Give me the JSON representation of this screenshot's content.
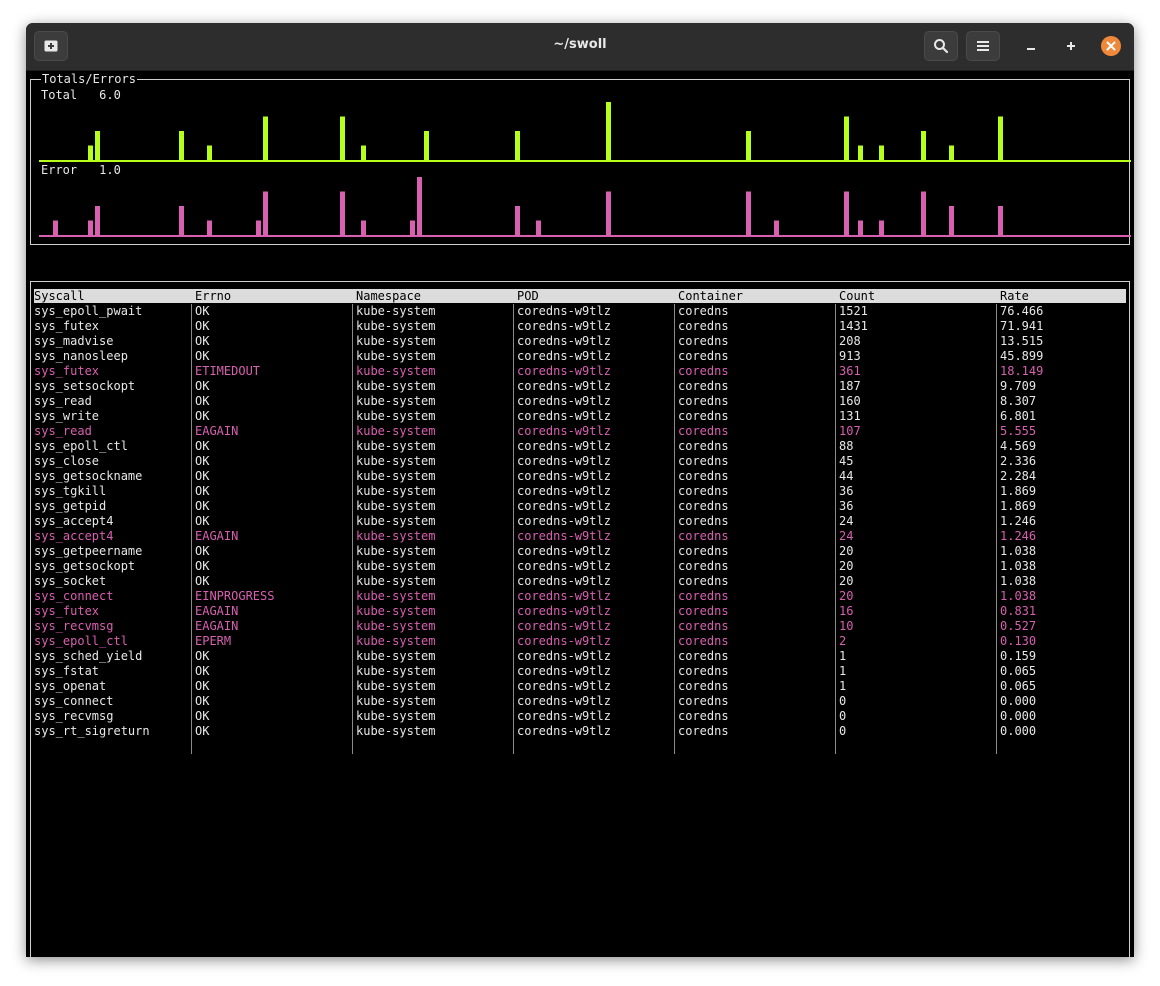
{
  "window": {
    "title": "~/swoll"
  },
  "toolbar": {
    "new_tab_icon": "new-tab-icon",
    "search_icon": "search-icon",
    "menu_icon": "hamburger-menu-icon",
    "minimize_icon": "minimize-icon",
    "maximize_icon": "maximize-icon",
    "close_icon": "close-icon"
  },
  "colors": {
    "total_bars": "#b6ff1a",
    "error_bars": "#d860b0",
    "error_row_text": "#d860b0",
    "close_button": "#f0883a"
  },
  "totals_panel": {
    "title": "Totals/Errors",
    "total_label": "Total",
    "total_value": "6.0",
    "error_label": "Error",
    "error_value": "1.0"
  },
  "chart_data": [
    {
      "type": "bar",
      "series": [
        {
          "name": "Total",
          "values": [
            0,
            0,
            0,
            0,
            0,
            0,
            0,
            1,
            2,
            0,
            0,
            0,
            0,
            0,
            0,
            0,
            0,
            0,
            0,
            0,
            2,
            0,
            0,
            0,
            1,
            0,
            0,
            0,
            0,
            0,
            0,
            0,
            3,
            0,
            0,
            0,
            0,
            0,
            0,
            0,
            0,
            0,
            0,
            3,
            0,
            0,
            1,
            0,
            0,
            0,
            0,
            0,
            0,
            0,
            0,
            2,
            0,
            0,
            0,
            0,
            0,
            0,
            0,
            0,
            0,
            0,
            0,
            0,
            2,
            0,
            0,
            0,
            0,
            0,
            0,
            0,
            0,
            0,
            0,
            0,
            0,
            4,
            0,
            0,
            0,
            0,
            0,
            0,
            0,
            0,
            0,
            0,
            0,
            0,
            0,
            0,
            0,
            0,
            0,
            0,
            0,
            2,
            0,
            0,
            0,
            0,
            0,
            0,
            0,
            0,
            0,
            0,
            0,
            0,
            0,
            3,
            0,
            1,
            0,
            0,
            1,
            0,
            0,
            0,
            0,
            0,
            2,
            0,
            0,
            0,
            1,
            0,
            0,
            0,
            0,
            0,
            0,
            3,
            0,
            0,
            0,
            0,
            0,
            0,
            0,
            0,
            0,
            0,
            0,
            0,
            0,
            0,
            0,
            0,
            0,
            0,
            0,
            0,
            2,
            0,
            0,
            0,
            0,
            0,
            0,
            0,
            0,
            0,
            2,
            1,
            0,
            0,
            0,
            0,
            0,
            0,
            0,
            0,
            0,
            0,
            2
          ]
        }
      ],
      "ylim": [
        0,
        4
      ]
    },
    {
      "type": "bar",
      "series": [
        {
          "name": "Error",
          "values": [
            0,
            0,
            1,
            0,
            0,
            0,
            0,
            1,
            2,
            0,
            0,
            0,
            0,
            0,
            0,
            0,
            0,
            0,
            0,
            0,
            2,
            0,
            0,
            0,
            1,
            0,
            0,
            0,
            0,
            0,
            0,
            1,
            3,
            0,
            0,
            0,
            0,
            0,
            0,
            0,
            0,
            0,
            0,
            3,
            0,
            0,
            1,
            0,
            0,
            0,
            0,
            0,
            0,
            1,
            4,
            0,
            0,
            0,
            0,
            0,
            0,
            0,
            0,
            0,
            0,
            0,
            0,
            0,
            2,
            0,
            0,
            1,
            0,
            0,
            0,
            0,
            0,
            0,
            0,
            0,
            0,
            3,
            0,
            0,
            0,
            0,
            0,
            0,
            0,
            0,
            0,
            0,
            0,
            0,
            0,
            0,
            0,
            0,
            0,
            0,
            0,
            3,
            0,
            0,
            0,
            1,
            0,
            0,
            0,
            0,
            0,
            0,
            0,
            0,
            0,
            3,
            0,
            1,
            0,
            0,
            1,
            0,
            0,
            0,
            0,
            0,
            3,
            0,
            0,
            0,
            2,
            0,
            0,
            0,
            0,
            0,
            0,
            2,
            0,
            0,
            0,
            0,
            0,
            0,
            0,
            0,
            0,
            0,
            0,
            0,
            0,
            0,
            0,
            0,
            0,
            0,
            0,
            0,
            2,
            0,
            0,
            1,
            0,
            0,
            0,
            0,
            0,
            0,
            3,
            1,
            0,
            0,
            0,
            0,
            0,
            0,
            0,
            0,
            0,
            0,
            3
          ]
        }
      ],
      "ylim": [
        0,
        4
      ]
    }
  ],
  "table": {
    "columns": [
      "Syscall",
      "Errno",
      "Namespace",
      "POD",
      "Container",
      "Count",
      "Rate"
    ],
    "rows": [
      {
        "cells": [
          "sys_epoll_pwait",
          "OK",
          "kube-system",
          "coredns-w9tlz",
          "coredns",
          "1521",
          "76.466"
        ],
        "error": false
      },
      {
        "cells": [
          "sys_futex",
          "OK",
          "kube-system",
          "coredns-w9tlz",
          "coredns",
          "1431",
          "71.941"
        ],
        "error": false
      },
      {
        "cells": [
          "sys_madvise",
          "OK",
          "kube-system",
          "coredns-w9tlz",
          "coredns",
          "208",
          "13.515"
        ],
        "error": false
      },
      {
        "cells": [
          "sys_nanosleep",
          "OK",
          "kube-system",
          "coredns-w9tlz",
          "coredns",
          "913",
          "45.899"
        ],
        "error": false
      },
      {
        "cells": [
          "sys_futex",
          "ETIMEDOUT",
          "kube-system",
          "coredns-w9tlz",
          "coredns",
          "361",
          "18.149"
        ],
        "error": true
      },
      {
        "cells": [
          "sys_setsockopt",
          "OK",
          "kube-system",
          "coredns-w9tlz",
          "coredns",
          "187",
          "9.709"
        ],
        "error": false
      },
      {
        "cells": [
          "sys_read",
          "OK",
          "kube-system",
          "coredns-w9tlz",
          "coredns",
          "160",
          "8.307"
        ],
        "error": false
      },
      {
        "cells": [
          "sys_write",
          "OK",
          "kube-system",
          "coredns-w9tlz",
          "coredns",
          "131",
          "6.801"
        ],
        "error": false
      },
      {
        "cells": [
          "sys_read",
          "EAGAIN",
          "kube-system",
          "coredns-w9tlz",
          "coredns",
          "107",
          "5.555"
        ],
        "error": true
      },
      {
        "cells": [
          "sys_epoll_ctl",
          "OK",
          "kube-system",
          "coredns-w9tlz",
          "coredns",
          "88",
          "4.569"
        ],
        "error": false
      },
      {
        "cells": [
          "sys_close",
          "OK",
          "kube-system",
          "coredns-w9tlz",
          "coredns",
          "45",
          "2.336"
        ],
        "error": false
      },
      {
        "cells": [
          "sys_getsockname",
          "OK",
          "kube-system",
          "coredns-w9tlz",
          "coredns",
          "44",
          "2.284"
        ],
        "error": false
      },
      {
        "cells": [
          "sys_tgkill",
          "OK",
          "kube-system",
          "coredns-w9tlz",
          "coredns",
          "36",
          "1.869"
        ],
        "error": false
      },
      {
        "cells": [
          "sys_getpid",
          "OK",
          "kube-system",
          "coredns-w9tlz",
          "coredns",
          "36",
          "1.869"
        ],
        "error": false
      },
      {
        "cells": [
          "sys_accept4",
          "OK",
          "kube-system",
          "coredns-w9tlz",
          "coredns",
          "24",
          "1.246"
        ],
        "error": false
      },
      {
        "cells": [
          "sys_accept4",
          "EAGAIN",
          "kube-system",
          "coredns-w9tlz",
          "coredns",
          "24",
          "1.246"
        ],
        "error": true
      },
      {
        "cells": [
          "sys_getpeername",
          "OK",
          "kube-system",
          "coredns-w9tlz",
          "coredns",
          "20",
          "1.038"
        ],
        "error": false
      },
      {
        "cells": [
          "sys_getsockopt",
          "OK",
          "kube-system",
          "coredns-w9tlz",
          "coredns",
          "20",
          "1.038"
        ],
        "error": false
      },
      {
        "cells": [
          "sys_socket",
          "OK",
          "kube-system",
          "coredns-w9tlz",
          "coredns",
          "20",
          "1.038"
        ],
        "error": false
      },
      {
        "cells": [
          "sys_connect",
          "EINPROGRESS",
          "kube-system",
          "coredns-w9tlz",
          "coredns",
          "20",
          "1.038"
        ],
        "error": true
      },
      {
        "cells": [
          "sys_futex",
          "EAGAIN",
          "kube-system",
          "coredns-w9tlz",
          "coredns",
          "16",
          "0.831"
        ],
        "error": true
      },
      {
        "cells": [
          "sys_recvmsg",
          "EAGAIN",
          "kube-system",
          "coredns-w9tlz",
          "coredns",
          "10",
          "0.527"
        ],
        "error": true
      },
      {
        "cells": [
          "sys_epoll_ctl",
          "EPERM",
          "kube-system",
          "coredns-w9tlz",
          "coredns",
          "2",
          "0.130"
        ],
        "error": true
      },
      {
        "cells": [
          "sys_sched_yield",
          "OK",
          "kube-system",
          "coredns-w9tlz",
          "coredns",
          "1",
          "0.159"
        ],
        "error": false
      },
      {
        "cells": [
          "sys_fstat",
          "OK",
          "kube-system",
          "coredns-w9tlz",
          "coredns",
          "1",
          "0.065"
        ],
        "error": false
      },
      {
        "cells": [
          "sys_openat",
          "OK",
          "kube-system",
          "coredns-w9tlz",
          "coredns",
          "1",
          "0.065"
        ],
        "error": false
      },
      {
        "cells": [
          "sys_connect",
          "OK",
          "kube-system",
          "coredns-w9tlz",
          "coredns",
          "0",
          "0.000"
        ],
        "error": false
      },
      {
        "cells": [
          "sys_recvmsg",
          "OK",
          "kube-system",
          "coredns-w9tlz",
          "coredns",
          "0",
          "0.000"
        ],
        "error": false
      },
      {
        "cells": [
          "sys_rt_sigreturn",
          "OK",
          "kube-system",
          "coredns-w9tlz",
          "coredns",
          "0",
          "0.000"
        ],
        "error": false
      }
    ]
  }
}
